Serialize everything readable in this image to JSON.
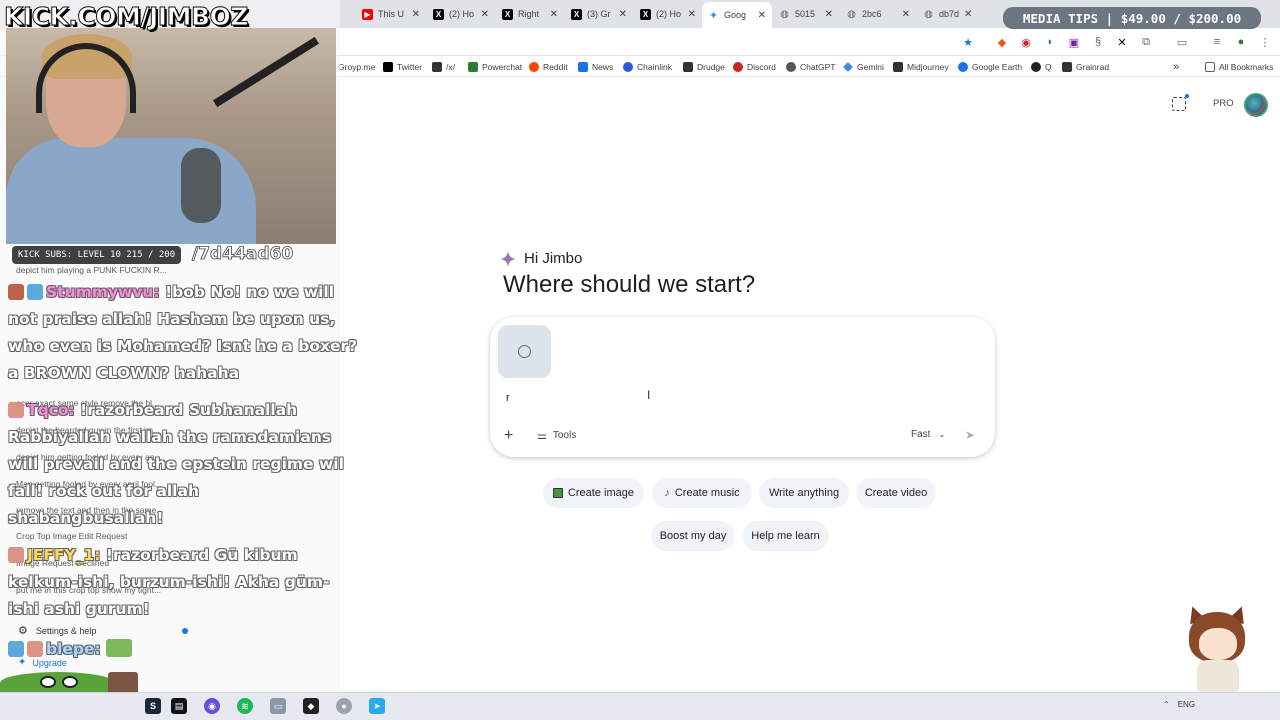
{
  "browser": {
    "tabs": [
      {
        "label": "This U",
        "icon": "youtube-icon",
        "color": "#ff0000"
      },
      {
        "label": "(2) Ho",
        "icon": "x-icon",
        "color": "#000000"
      },
      {
        "label": "Right",
        "icon": "x-icon",
        "color": "#000000"
      },
      {
        "label": "(3) Gr",
        "icon": "x-icon",
        "color": "#000000"
      },
      {
        "label": "(2) Ho",
        "icon": "x-icon",
        "color": "#000000"
      },
      {
        "label": "Goog",
        "icon": "gemini-icon",
        "color": "#4285f4",
        "active": true
      },
      {
        "label": "5015",
        "icon": "globe-icon",
        "color": "#5f6368"
      },
      {
        "label": "2bc6",
        "icon": "globe-icon",
        "color": "#5f6368"
      },
      {
        "label": "db7d",
        "icon": "globe-icon",
        "color": "#5f6368"
      }
    ],
    "bookmarks": [
      {
        "label": "Groyp.me",
        "color": "#888888"
      },
      {
        "label": "Twitter",
        "color": "#000000"
      },
      {
        "label": "/x/",
        "color": "#333333"
      },
      {
        "label": "Powerchat",
        "color": "#2e7d32"
      },
      {
        "label": "Reddit",
        "color": "#ff4500"
      },
      {
        "label": "News",
        "color": "#1a73e8"
      },
      {
        "label": "Chainlink",
        "color": "#2a5ada"
      },
      {
        "label": "Drudge",
        "color": "#333333"
      },
      {
        "label": "Discord",
        "color": "#c62828"
      },
      {
        "label": "ChatGPT",
        "color": "#555555"
      },
      {
        "label": "Gemini",
        "color": "#4285f4"
      },
      {
        "label": "Midjourney",
        "color": "#333333"
      },
      {
        "label": "Google Earth",
        "color": "#1a73e8"
      },
      {
        "label": "Q",
        "color": "#222222"
      },
      {
        "label": "Grainrad",
        "color": "#333333"
      }
    ],
    "bookmarks_overflow": "»",
    "all_bookmarks": "All Bookmarks"
  },
  "gemini": {
    "greeting": "Hi Jimbo",
    "headline": "Where should we start?",
    "prompt_value": "r",
    "tools_label": "Tools",
    "model_label": "Fast",
    "pro_label": "PRO",
    "chips": [
      {
        "label": "Create image",
        "icon": "image-icon"
      },
      {
        "label": "Create music",
        "icon": "guitar-icon"
      },
      {
        "label": "Write anything"
      },
      {
        "label": "Create video"
      },
      {
        "label": "Boost my day"
      },
      {
        "label": "Help me learn"
      }
    ],
    "sidebar_settings": "Settings & help",
    "sidebar_upgrade": "Upgrade"
  },
  "stream": {
    "banner": "KICK.COM/JIMBOZ",
    "subs": "KICK SUBS: LEVEL 10 215 / 200",
    "sub_url": "/7d44ad60",
    "media_tips": "MEDIA TIPS | $49.00 / $200.00",
    "history": [
      "depict him playing a PUNK FUCKIN R...",
      "ecor exact same style remove the bl...",
      "depict the bearded guy in the first im...",
      "depict him getting fooled by every ap...",
      "Man getting fooled by every april fool...",
      "remove the text and then in the same...",
      "Crop Top Image Edit Request",
      "Image Request Declined",
      "put me in this crop top show my tight..."
    ],
    "chat": [
      {
        "user": "Stummywvu:",
        "message": "!bob No! no we will not praise allah! Hashem be upon us, who even is Mohamed? Isnt he a boxer? a BROWN CLOWN? hahaha"
      },
      {
        "user": "Tqco:",
        "message": "!razorbeard Subhanallah Rabbiyallah wallah the ramadamians will prevail and the epstein regime wil fall! rock out for allah shabangbusallah!"
      },
      {
        "user": "JEFFY_1:",
        "message": "!razorbeard Gū kibum kelkum-ishi, burzum-ishi! Akha gūm-ishi ashi gurum!"
      },
      {
        "user": "blepe:",
        "message": ""
      }
    ]
  },
  "taskbar": {
    "tray_text": "ENG"
  }
}
